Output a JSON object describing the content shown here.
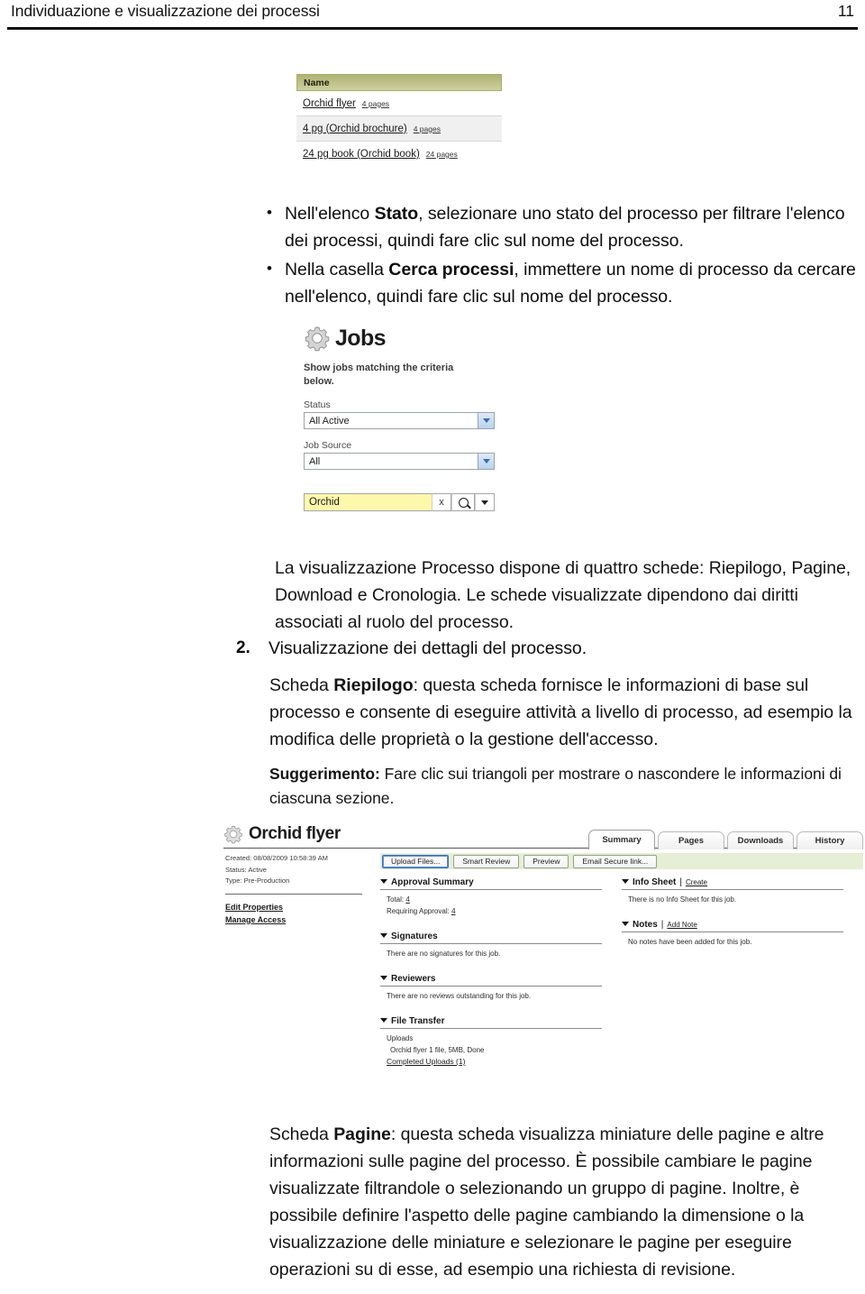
{
  "header": {
    "title": "Individuazione e visualizzazione dei processi",
    "page_number": "11"
  },
  "screenshot_name_table": {
    "column_header": "Name",
    "rows": [
      {
        "name": "Orchid flyer",
        "pages": "4 pages"
      },
      {
        "name": "4 pg (Orchid brochure)",
        "pages": "4 pages"
      },
      {
        "name": "24 pg book (Orchid book)",
        "pages": "24 pages"
      }
    ]
  },
  "bullets": [
    {
      "prefix": "Nell'elenco ",
      "bold": "Stato",
      "suffix": ", selezionare uno stato del processo per filtrare l'elenco dei processi, quindi fare clic sul nome del processo."
    },
    {
      "prefix": "Nella casella ",
      "bold": "Cerca processi",
      "suffix": ", immettere un nome di processo da cercare nell'elenco, quindi fare clic sul nome del processo."
    }
  ],
  "screenshot_jobs_panel": {
    "icon": "gear-icon",
    "title": "Jobs",
    "description": "Show jobs matching the criteria below.",
    "status_label": "Status",
    "status_value": "All Active",
    "job_source_label": "Job Source",
    "job_source_value": "All",
    "search_value": "Orchid",
    "clear_button": "x",
    "search_icon": "magnifier-icon",
    "dropdown_icon": "caret-down-icon"
  },
  "paragraph_tabs": "La visualizzazione Processo dispone di quattro schede: Riepilogo, Pagine, Download e Cronologia. Le schede visualizzate dipendono dai diritti associati al ruolo del processo.",
  "numbered_item": {
    "number": "2.",
    "text": "Visualizzazione dei dettagli del processo."
  },
  "paragraph_summary": {
    "prefix": "Scheda ",
    "bold": "Riepilogo",
    "suffix": ": questa scheda fornisce le informazioni di base sul processo e consente di eseguire attività a livello di processo, ad esempio la modifica delle proprietà o la gestione dell'accesso."
  },
  "paragraph_tip": {
    "bold": "Suggerimento:",
    "text": " Fare clic sui triangoli per mostrare o nascondere le informazioni di ciascuna sezione."
  },
  "screenshot_flyer": {
    "icon": "gear-icon",
    "title": "Orchid flyer",
    "tabs": [
      {
        "label": "Summary",
        "active": true
      },
      {
        "label": "Pages",
        "active": false
      },
      {
        "label": "Downloads",
        "active": false
      },
      {
        "label": "History",
        "active": false
      }
    ],
    "meta": [
      "Created: 08/08/2009 10:58:39 AM",
      "Status: Active",
      "Type: Pre-Production"
    ],
    "left_links": [
      "Edit Properties",
      "Manage Access"
    ],
    "buttons": [
      {
        "label": "Upload Files...",
        "focused": true
      },
      {
        "label": "Smart Review",
        "focused": false
      },
      {
        "label": "Preview",
        "focused": false
      },
      {
        "label": "Email Secure link...",
        "focused": false
      }
    ],
    "sections": {
      "approval_summary": {
        "title": "Approval Summary",
        "total_label": "Total:",
        "total_value": "4",
        "requiring_label": "Requiring Approval:",
        "requiring_value": "4"
      },
      "info_sheet": {
        "title": "Info Sheet",
        "action": "Create",
        "body": "There is no Info Sheet for this job."
      },
      "signatures": {
        "title": "Signatures",
        "body": "There are no signatures for this job."
      },
      "notes": {
        "title": "Notes",
        "action": "Add Note",
        "body": "No notes have been added for this job."
      },
      "reviewers": {
        "title": "Reviewers",
        "body": "There are no reviews outstanding for this job."
      },
      "file_transfer": {
        "title": "File Transfer",
        "uploads_label": "Uploads",
        "upload_item": "Orchid flyer 1 file, 5MB, Done",
        "completed_link": "Completed Uploads (1)"
      }
    }
  },
  "paragraph_pages": {
    "prefix": "Scheda ",
    "bold": "Pagine",
    "suffix": ": questa scheda visualizza miniature delle pagine e altre informazioni sulle pagine del processo. È possibile cambiare le pagine visualizzate filtrandole o selezionando un gruppo di pagine. Inoltre, è possibile definire l'aspetto delle pagine cambiando la dimensione o la visualizzazione delle miniature e selezionare le pagine per eseguire operazioni su di esse, ad esempio una richiesta di revisione."
  },
  "colors": {
    "table_header": "#b9bd85",
    "button_bar": "#e6eed6",
    "search_field": "#fdf8ab"
  }
}
